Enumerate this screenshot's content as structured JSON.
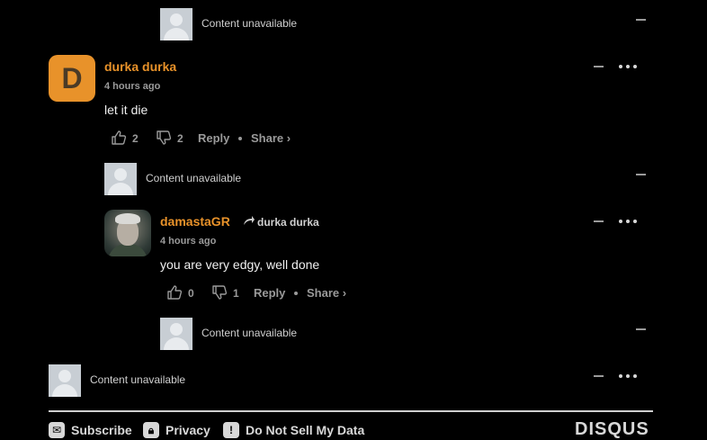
{
  "comments": {
    "hidden_1": {
      "text": "Content unavailable"
    },
    "main": {
      "avatar_letter": "D",
      "author": "durka durka",
      "time": "4 hours ago",
      "message": "let it die",
      "upvotes": "2",
      "downvotes": "2",
      "reply_label": "Reply",
      "share_label": "Share ›"
    },
    "hidden_2": {
      "text": "Content unavailable"
    },
    "reply": {
      "author": "damastaGR",
      "reply_to": "durka durka",
      "time": "4 hours ago",
      "message": "you are very edgy, well done",
      "upvotes": "0",
      "downvotes": "1",
      "reply_label": "Reply",
      "share_label": "Share ›"
    },
    "hidden_3": {
      "text": "Content unavailable"
    },
    "hidden_4": {
      "text": "Content unavailable"
    }
  },
  "footer": {
    "subscribe": "Subscribe",
    "privacy": "Privacy",
    "do_not_sell": "Do Not Sell My Data",
    "brand": "DISQUS"
  },
  "colors": {
    "background": "#000000",
    "author": "#e8922a",
    "muted": "#9a9a9a"
  }
}
